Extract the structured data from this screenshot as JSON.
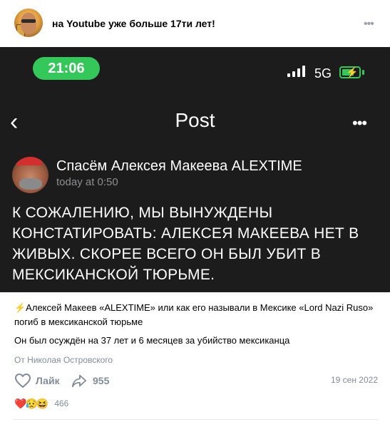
{
  "header": {
    "title": "на Youtube уже больше 17ти лет!",
    "more_icon": "more-horizontal-icon"
  },
  "phone": {
    "status_bar": {
      "time": "21:06",
      "network": "5G",
      "signal_icon": "signal-bars-icon",
      "battery_icon": "battery-charging-icon"
    },
    "nav": {
      "back_icon": "chevron-left-icon",
      "title": "Post",
      "more_icon": "more-horizontal-icon"
    },
    "author": {
      "name": "Спасём Алексея Макеева ALEXTIME",
      "time": "today at 0:50"
    },
    "body": "К СОЖАЛЕНИЮ, МЫ ВЫНУЖДЕНЫ КОНСТАТИРОВАТЬ: АЛЕКСЕЯ МАКЕЕВА НЕТ В ЖИВЫХ. СКОРЕЕ ВСЕГО ОН БЫЛ УБИТ В МЕКСИКАНСКОЙ ТЮРЬМЕ."
  },
  "caption": {
    "line1": "⚡Алексей Макеев «ALEXTIME» или как его называли в Мексике «Lord Nazi Ruso» погиб в мексиканской тюрьме",
    "line2": "Он был осуждён на 37 лет и 6 месяцев за убийство мексиканца",
    "source": "От Николая Островского"
  },
  "actions": {
    "like_label": "Лайк",
    "share_count": "955",
    "date": "19 сен 2022"
  },
  "reactions": {
    "items": [
      "❤️",
      "😥",
      "😆"
    ],
    "count": "466"
  },
  "colors": {
    "phone_bg": "#1c1c1d",
    "accent_green": "#34c759",
    "muted": "#818c99"
  }
}
